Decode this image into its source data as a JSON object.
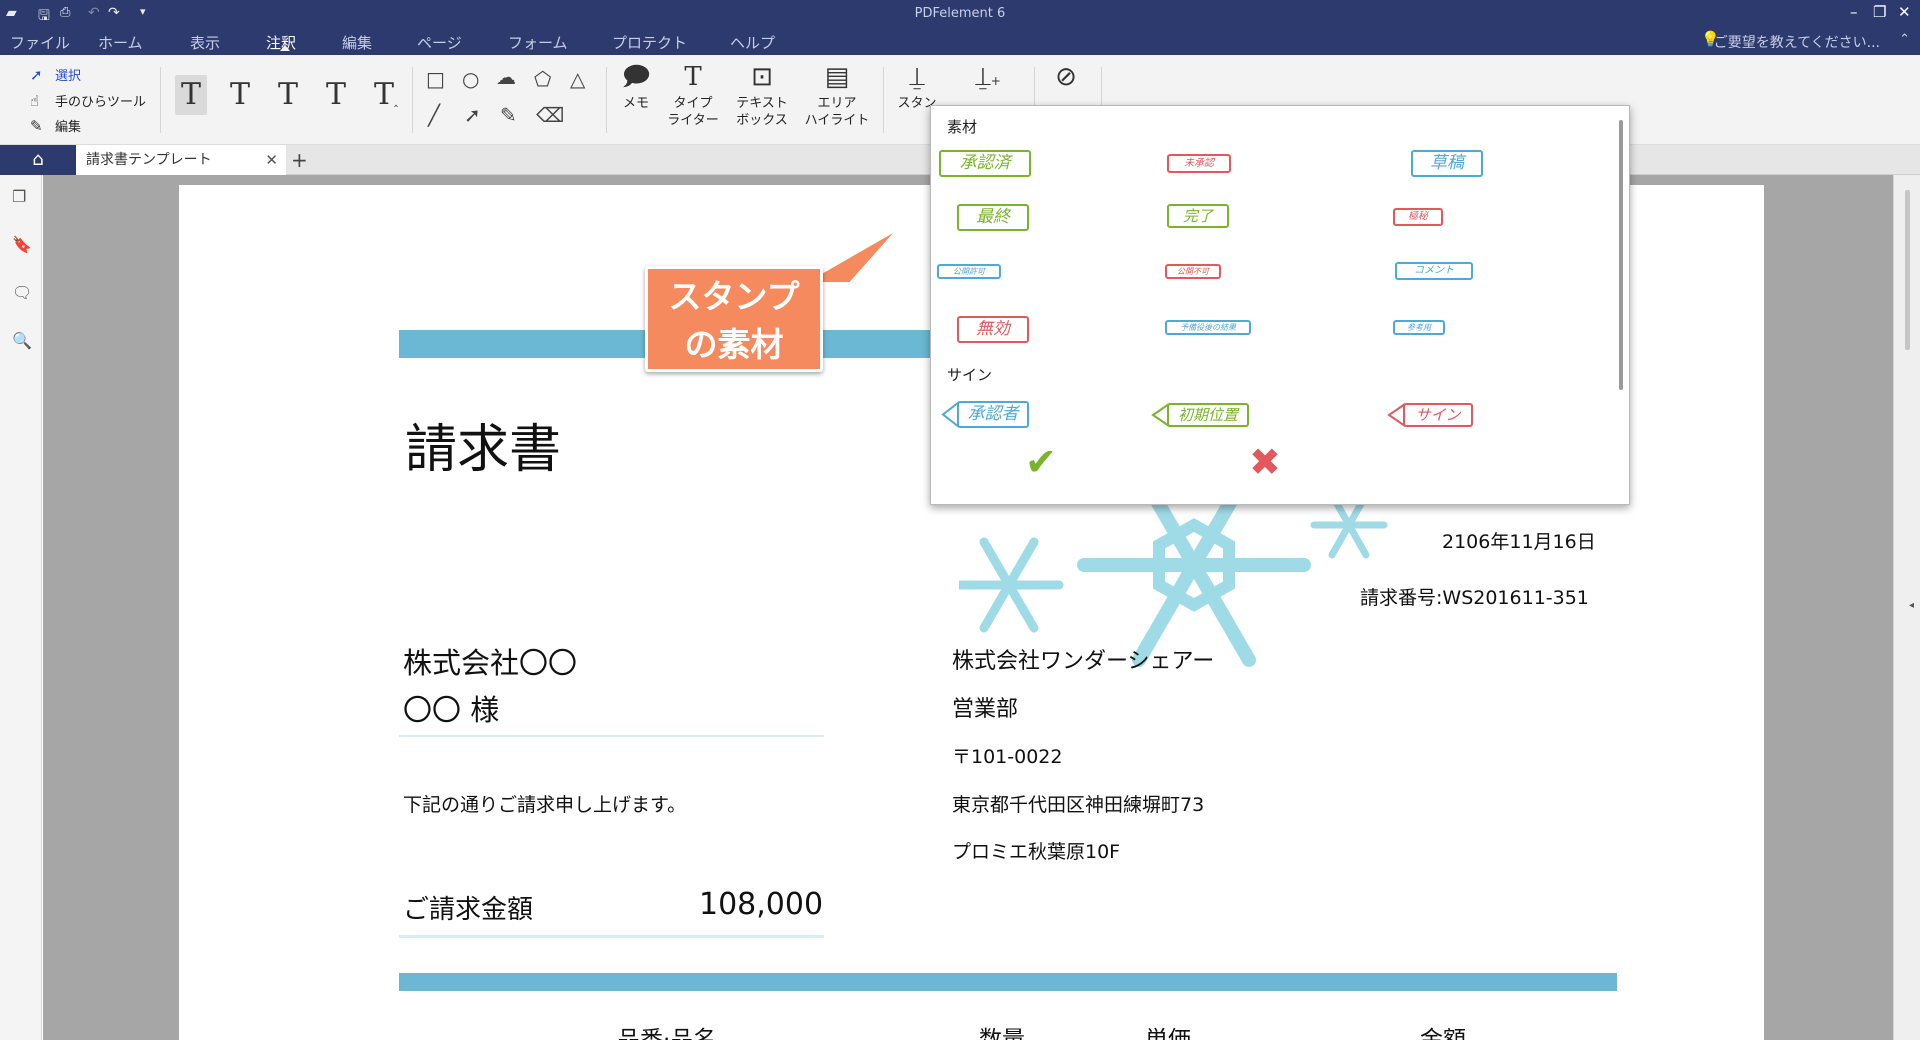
{
  "app": {
    "title": "PDFelement 6"
  },
  "menu": {
    "items": [
      "ファイル",
      "ホーム",
      "表示",
      "注釈",
      "編集",
      "ページ",
      "フォーム",
      "プロテクト",
      "ヘルプ"
    ],
    "active_index": 3,
    "request_text": "ご要望を教えてください..."
  },
  "ribbon": {
    "select_label": "選択",
    "hand_label": "手のひらツール",
    "edit_label": "編集",
    "note_label": "メモ",
    "typewriter_label_1": "タイプ",
    "typewriter_label_2": "ライター",
    "textbox_label_1": "テキスト",
    "textbox_label_2": "ボックス",
    "area_label_1": "エリア",
    "area_label_2": "ハイライト",
    "stamp_label": "スタン"
  },
  "tabs": {
    "document_tab": "請求書テンプレート"
  },
  "callout": {
    "line1": "スタンプ",
    "line2": "の素材"
  },
  "stamp_panel": {
    "section_material": "素材",
    "section_sign": "サイン",
    "stamps": [
      {
        "label": "承認済",
        "color": "green"
      },
      {
        "label": "未承認",
        "color": "red"
      },
      {
        "label": "草稿",
        "color": "blue"
      },
      {
        "label": "最終",
        "color": "green"
      },
      {
        "label": "完了",
        "color": "green"
      },
      {
        "label": "極秘",
        "color": "red"
      },
      {
        "label": "公開許可",
        "color": "blue"
      },
      {
        "label": "公開不可",
        "color": "red"
      },
      {
        "label": "コメント",
        "color": "blue"
      },
      {
        "label": "無効",
        "color": "red"
      },
      {
        "label": "予備役後の結果",
        "color": "blue"
      },
      {
        "label": "参考用",
        "color": "blue"
      }
    ],
    "signs": [
      {
        "label": "承認者",
        "color": "blue"
      },
      {
        "label": "初期位置",
        "color": "green"
      },
      {
        "label": "サイン",
        "color": "red"
      }
    ]
  },
  "document": {
    "title": "請求書",
    "date": "2106年11月16日",
    "invoice_no": "請求番号:WS201611-351",
    "client_company": "株式会社〇〇",
    "client_name": "〇〇 様",
    "issuer_company": "株式会社ワンダーシェアー",
    "issuer_dept": "営業部",
    "postal": "〒101-0022",
    "address": "東京都千代田区神田練塀町73",
    "building": "プロミエ秋葉原10F",
    "intro": "下記の通りご請求申し上げます。",
    "amount_label": "ご請求金額",
    "amount_value": "108,000",
    "columns": [
      "品番·品名",
      "数量",
      "単価",
      "金額"
    ]
  },
  "colors": {
    "titlebar": "#2d3a6e",
    "accent_band": "#6ab8d3",
    "callout": "#f48a5e",
    "snowflake": "#9fdbe6",
    "stamp_green": "#7ab42c",
    "stamp_red": "#e2585c",
    "stamp_blue": "#4fa9d6"
  }
}
